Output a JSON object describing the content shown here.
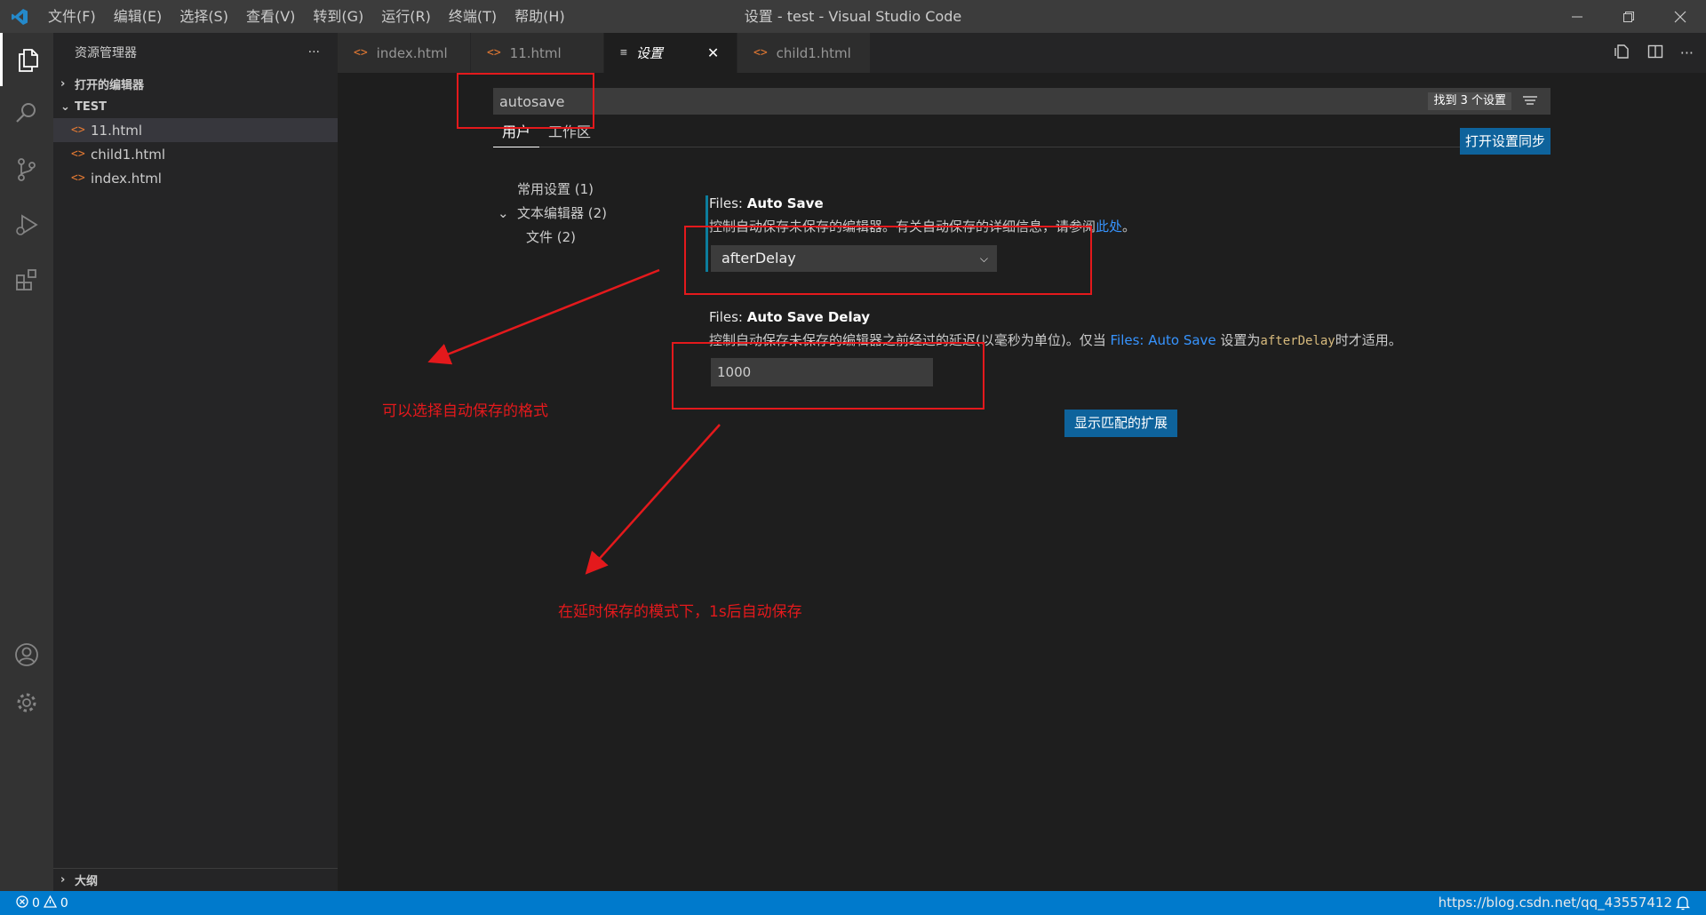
{
  "window": {
    "title": "设置 - test - Visual Studio Code",
    "menu": [
      "文件(F)",
      "编辑(E)",
      "选择(S)",
      "查看(V)",
      "转到(G)",
      "运行(R)",
      "终端(T)",
      "帮助(H)"
    ]
  },
  "sidebar": {
    "header": "资源管理器",
    "more": "···",
    "open_editors": "打开的编辑器",
    "folder": "TEST",
    "files": [
      "11.html",
      "child1.html",
      "index.html"
    ],
    "outline": "大纲"
  },
  "tabs": {
    "items": [
      "index.html",
      "11.html",
      "设置",
      "child1.html"
    ],
    "close": "✕"
  },
  "settings": {
    "search_value": "autosave",
    "search_count": "找到 3 个设置",
    "scope_user": "用户",
    "scope_workspace": "工作区",
    "sync_button": "打开设置同步",
    "toc": [
      "常用设置 (1)",
      "文本编辑器 (2)",
      "文件 (2)"
    ],
    "autosave": {
      "category": "Files: ",
      "name": "Auto Save",
      "desc_before": "控制自动保存未保存的编辑器。有关自动保存的详细信息，请参阅",
      "desc_link": "此处",
      "desc_after": "。",
      "value": "afterDelay"
    },
    "autosave_delay": {
      "category": "Files: ",
      "name": "Auto Save Delay",
      "desc_before": "控制自动保存未保存的编辑器之前经过的延迟(以毫秒为单位)。仅当 ",
      "desc_link": "Files: Auto Save",
      "desc_mid": " 设置为",
      "desc_code": "afterDelay",
      "desc_after": "时才适用。",
      "value": "1000"
    },
    "extensions_button": "显示匹配的扩展"
  },
  "annotations": {
    "note1": "可以选择自动保存的格式",
    "note2": "在延时保存的模式下，1s后自动保存"
  },
  "status": {
    "errors": "0",
    "warnings": "0",
    "watermark": "https://blog.csdn.net/qq_43557412"
  },
  "colors": {
    "accent": "#007acc",
    "annotation": "#e4191c",
    "button": "#0e639c"
  }
}
